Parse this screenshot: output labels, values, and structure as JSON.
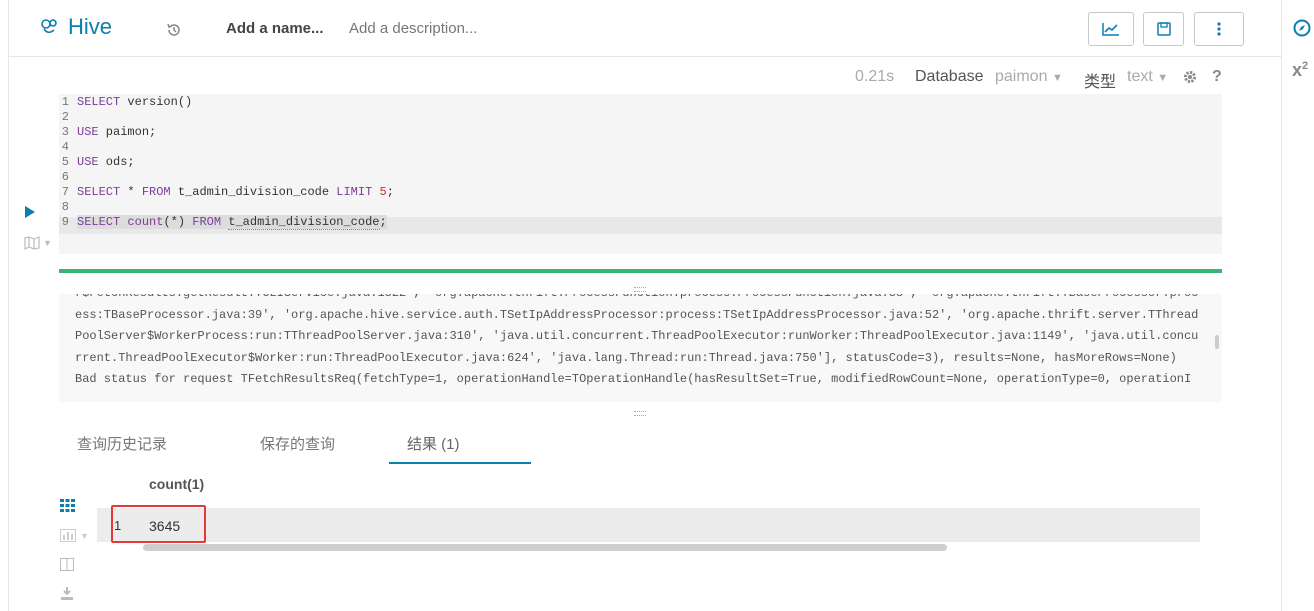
{
  "app": {
    "title": "Hive"
  },
  "header": {
    "name_placeholder": "Add a name...",
    "description_placeholder": "Add a description..."
  },
  "snippet": {
    "execution_time": "0.21s",
    "database_label": "Database",
    "database_value": "paimon",
    "type_label": "类型",
    "type_value": "text"
  },
  "editor": {
    "lines": [
      {
        "n": "1",
        "text": "SELECT version()"
      },
      {
        "n": "2",
        "text": ""
      },
      {
        "n": "3",
        "text": "USE paimon;"
      },
      {
        "n": "4",
        "text": ""
      },
      {
        "n": "5",
        "text": "USE ods;"
      },
      {
        "n": "6",
        "text": ""
      },
      {
        "n": "7",
        "text": "SELECT * FROM t_admin_division_code LIMIT 5;"
      },
      {
        "n": "8",
        "text": ""
      },
      {
        "n": "9",
        "text": "SELECT count(*) FROM t_admin_division_code;"
      }
    ]
  },
  "log": {
    "text": "r$FetchResults:getResult:TCLIService.java:1822', 'org.apache.thrift.ProcessFunction:process:ProcessFunction.java:38', 'org.apache.thrift.TBaseProcessor:process:TBaseProcessor.java:39', 'org.apache.hive.service.auth.TSetIpAddressProcessor:process:TSetIpAddressProcessor.java:52', 'org.apache.thrift.server.TThreadPoolServer$WorkerProcess:run:TThreadPoolServer.java:310', 'java.util.concurrent.ThreadPoolExecutor:runWorker:ThreadPoolExecutor.java:1149', 'java.util.concurrent.ThreadPoolExecutor$Worker:run:ThreadPoolExecutor.java:624', 'java.lang.Thread:run:Thread.java:750'], statusCode=3), results=None, hasMoreRows=None)",
    "text2": "Bad status for request TFetchResultsReq(fetchType=1, operationHandle=TOperationHandle(hasResultSet=True, modifiedRowCount=None, operationType=0, operationI"
  },
  "tabs": [
    {
      "label": "查询历史记录"
    },
    {
      "label": "保存的查询"
    },
    {
      "label": "结果 (1)"
    }
  ],
  "results": {
    "column": "count(1)",
    "rows": [
      {
        "index": "1",
        "value": "3645"
      }
    ]
  },
  "colors": {
    "accent": "#0b7fad",
    "progress": "#3cb371",
    "highlight": "#e53935"
  }
}
